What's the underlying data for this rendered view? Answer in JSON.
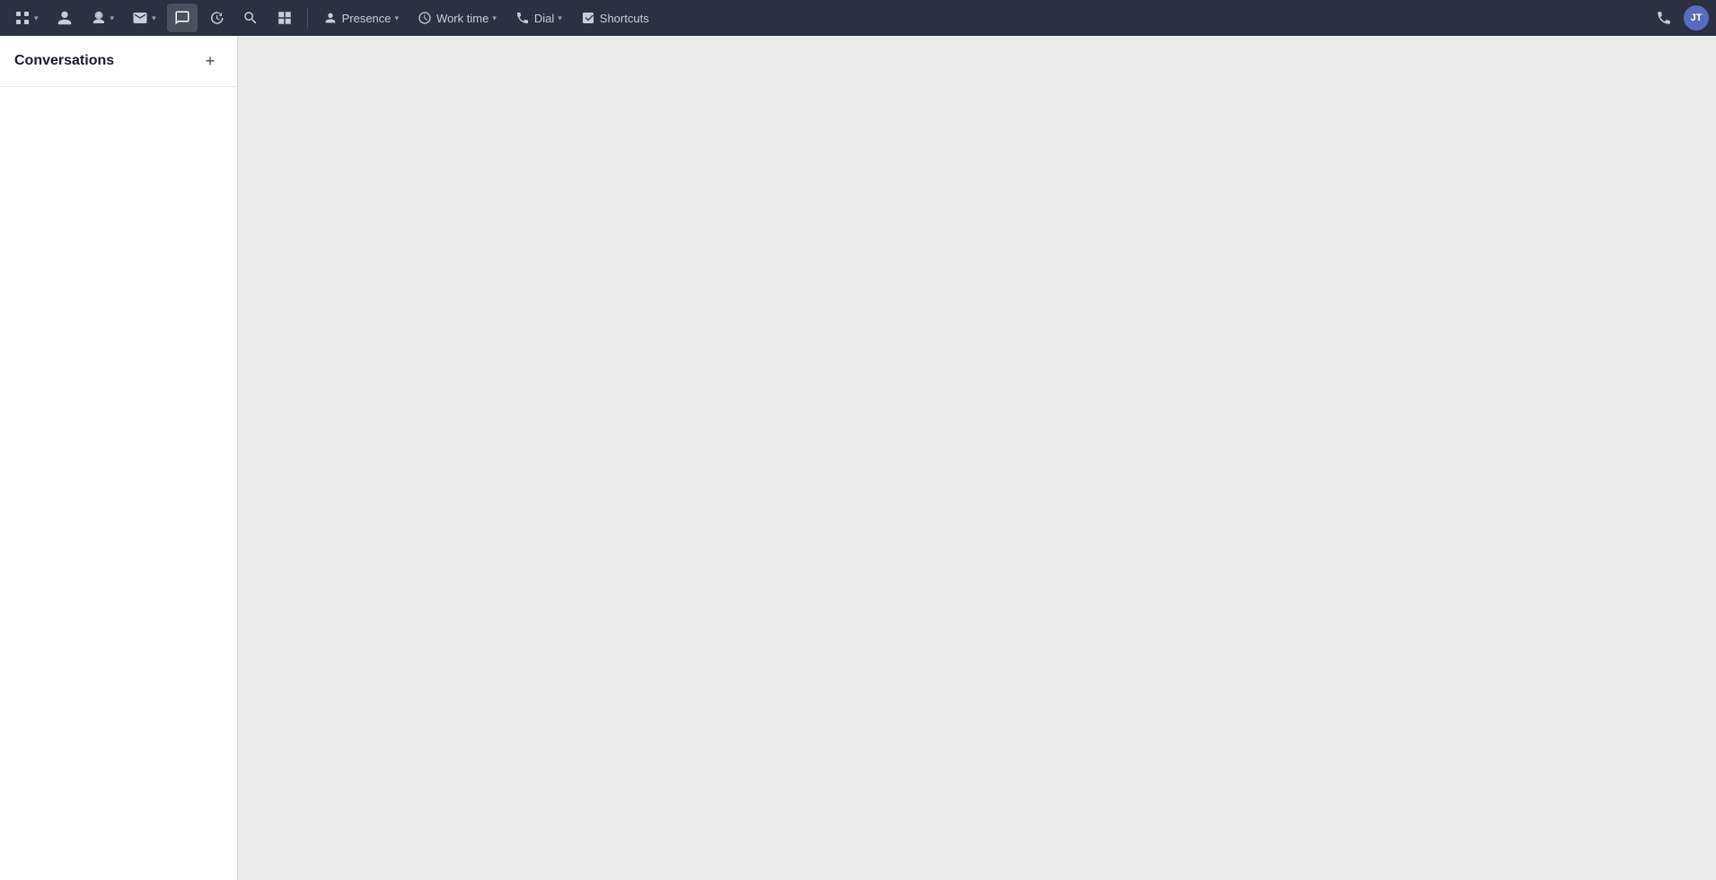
{
  "topbar": {
    "nav_items": [
      {
        "id": "logo",
        "icon": "grid",
        "label": "",
        "has_chevron": true,
        "active": false
      },
      {
        "id": "contacts",
        "icon": "person",
        "label": "",
        "has_chevron": false,
        "active": false
      },
      {
        "id": "profile",
        "icon": "person-circle",
        "label": "",
        "has_chevron": true,
        "active": false
      },
      {
        "id": "email",
        "icon": "envelope",
        "label": "",
        "has_chevron": false,
        "active": false
      },
      {
        "id": "email-chevron",
        "icon": "",
        "label": "",
        "has_chevron": true,
        "active": false
      },
      {
        "id": "chat",
        "icon": "chat",
        "label": "",
        "has_chevron": false,
        "active": true
      },
      {
        "id": "history",
        "icon": "clock",
        "label": "",
        "has_chevron": false,
        "active": false
      },
      {
        "id": "search",
        "icon": "search",
        "label": "",
        "has_chevron": false,
        "active": false
      },
      {
        "id": "grid2",
        "icon": "grid2",
        "label": "",
        "has_chevron": false,
        "active": false
      }
    ],
    "presence": {
      "label": "Presence",
      "has_chevron": true
    },
    "worktime": {
      "label": "Work time",
      "has_chevron": true
    },
    "dial": {
      "label": "Dial",
      "has_chevron": true
    },
    "shortcuts": {
      "label": "Shortcuts",
      "has_chevron": false
    },
    "avatar": {
      "initials": "JT"
    }
  },
  "sidebar": {
    "title": "Conversations",
    "add_button_label": "+"
  }
}
